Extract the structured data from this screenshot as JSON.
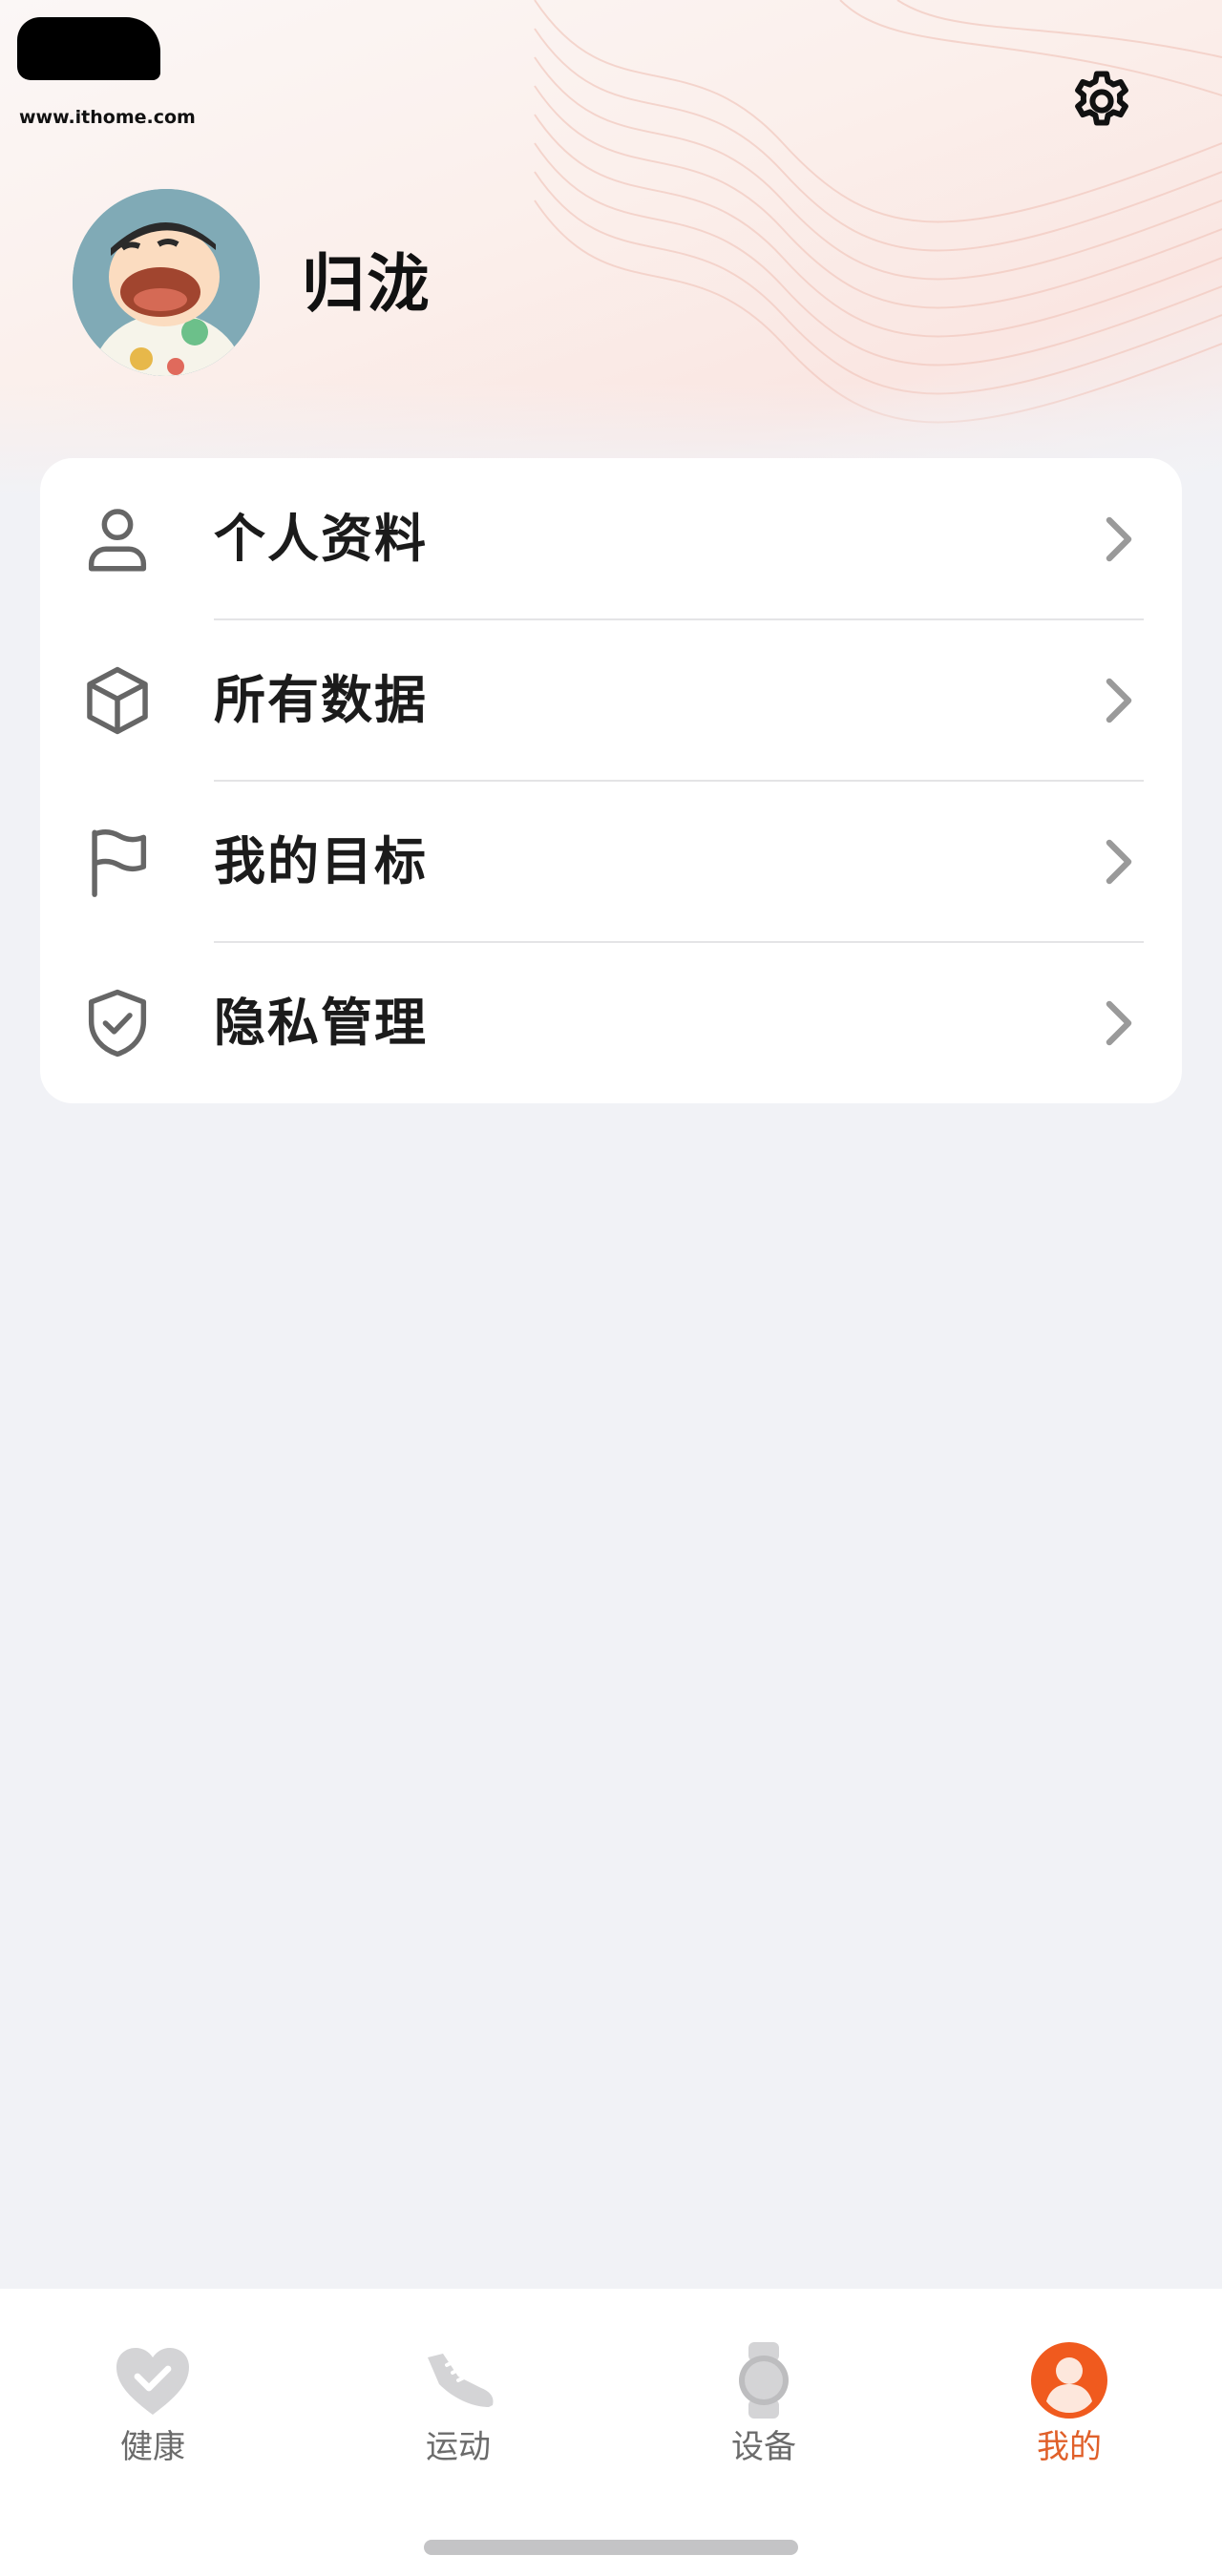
{
  "watermark": {
    "text": "www.ithome.com"
  },
  "header": {
    "username": "归泷"
  },
  "menu": {
    "items": [
      {
        "label": "个人资料",
        "icon": "person-icon"
      },
      {
        "label": "所有数据",
        "icon": "cube-icon"
      },
      {
        "label": "我的目标",
        "icon": "flag-icon"
      },
      {
        "label": "隐私管理",
        "icon": "shield-check-icon"
      }
    ]
  },
  "tabbar": {
    "active_index": 3,
    "tabs": [
      {
        "label": "健康",
        "icon": "heart-check-icon"
      },
      {
        "label": "运动",
        "icon": "sneaker-icon"
      },
      {
        "label": "设备",
        "icon": "watch-icon"
      },
      {
        "label": "我的",
        "icon": "user-circle-icon"
      }
    ]
  },
  "colors": {
    "accent": "#e0602a",
    "background": "#f1f2f6",
    "card": "#ffffff",
    "text_primary": "#1b1b1b",
    "tab_inactive_icon": "#d0d0d2"
  }
}
